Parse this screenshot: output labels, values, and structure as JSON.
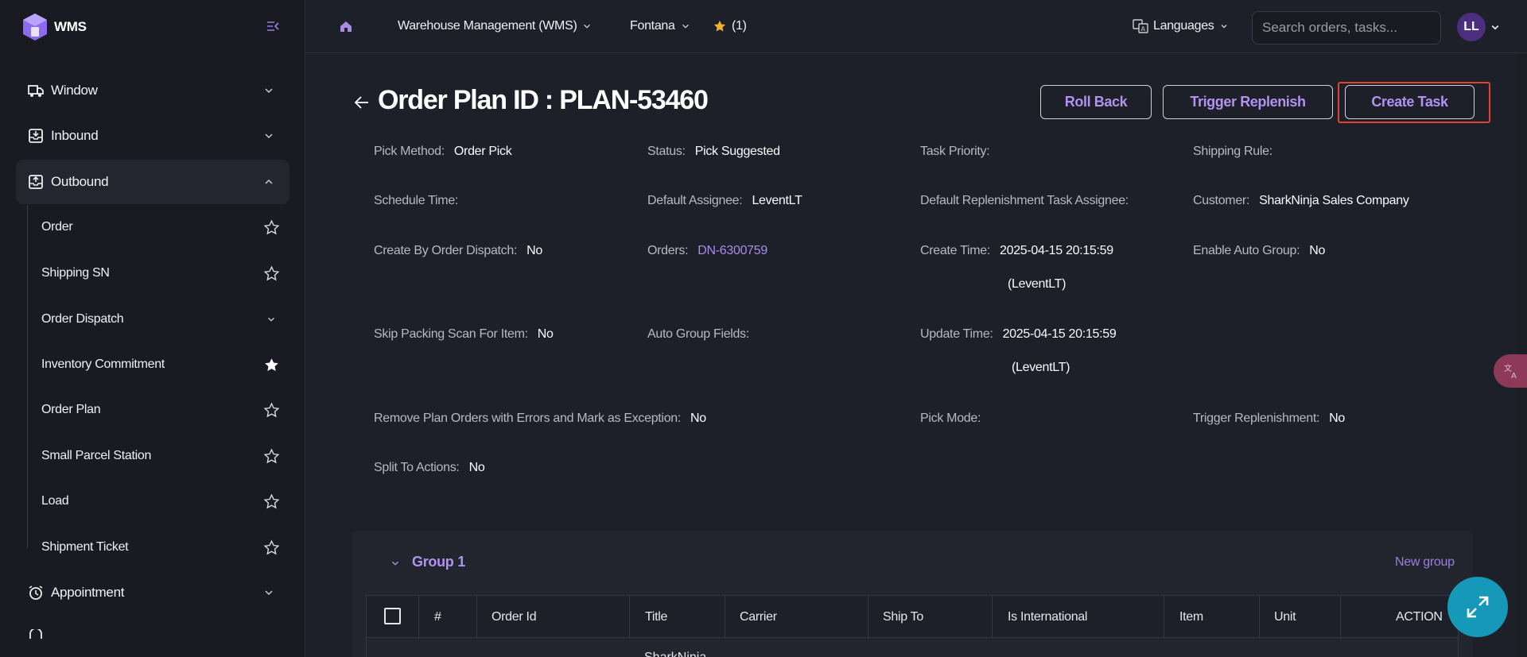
{
  "brand": {
    "name": "WMS"
  },
  "sidebar": {
    "groups": [
      {
        "label": "Window",
        "icon": "window-truck-icon"
      },
      {
        "label": "Inbound",
        "icon": "inbound-box-icon"
      },
      {
        "label": "Outbound",
        "icon": "outbound-box-icon"
      },
      {
        "label": "Appointment",
        "icon": "alarm-clock-icon"
      }
    ],
    "outbound_items": [
      {
        "label": "Order",
        "favorited": false
      },
      {
        "label": "Shipping SN",
        "favorited": false
      },
      {
        "label": "Order Dispatch",
        "expandable": true
      },
      {
        "label": "Inventory Commitment",
        "favorited": true
      },
      {
        "label": "Order Plan",
        "favorited": false
      },
      {
        "label": "Small Parcel Station",
        "favorited": false
      },
      {
        "label": "Load",
        "favorited": false
      },
      {
        "label": "Shipment Ticket",
        "favorited": false
      }
    ]
  },
  "topbar": {
    "app_selector": "Warehouse Management (WMS)",
    "facility": "Fontana",
    "favorites_count": "(1)",
    "languages": "Languages",
    "search_placeholder": "Search orders, tasks...",
    "avatar_initials": "LL"
  },
  "page": {
    "title": "Order Plan ID : PLAN-53460",
    "buttons": {
      "roll_back": "Roll Back",
      "trigger_replenish": "Trigger Replenish",
      "create_task": "Create Task"
    }
  },
  "details": {
    "pick_method": {
      "label": "Pick Method:",
      "value": "Order Pick"
    },
    "status": {
      "label": "Status:",
      "value": "Pick Suggested"
    },
    "task_priority": {
      "label": "Task Priority:",
      "value": ""
    },
    "shipping_rule": {
      "label": "Shipping Rule:",
      "value": ""
    },
    "schedule_time": {
      "label": "Schedule Time:",
      "value": ""
    },
    "default_assignee": {
      "label": "Default Assignee:",
      "value": "LeventLT"
    },
    "default_replenishment_assignee": {
      "label": "Default Replenishment Task Assignee:",
      "value": ""
    },
    "customer": {
      "label": "Customer:",
      "value": "SharkNinja Sales Company"
    },
    "create_by_order_dispatch": {
      "label": "Create By Order Dispatch:",
      "value": "No"
    },
    "orders": {
      "label": "Orders:",
      "value": "DN-6300759"
    },
    "create_time": {
      "label": "Create Time:",
      "value": "2025-04-15 20:15:59",
      "by": "(LeventLT)"
    },
    "enable_auto_group": {
      "label": "Enable Auto Group:",
      "value": "No"
    },
    "skip_packing_scan": {
      "label": "Skip Packing Scan For Item:",
      "value": "No"
    },
    "auto_group_fields": {
      "label": "Auto Group Fields:",
      "value": ""
    },
    "update_time": {
      "label": "Update Time:",
      "value": "2025-04-15 20:15:59",
      "by": "(LeventLT)"
    },
    "remove_plan_orders": {
      "label": "Remove Plan Orders with Errors and Mark as Exception:",
      "value": "No"
    },
    "pick_mode": {
      "label": "Pick Mode:",
      "value": ""
    },
    "trigger_replenishment": {
      "label": "Trigger Replenishment:",
      "value": "No"
    },
    "split_to_actions": {
      "label": "Split To Actions:",
      "value": "No"
    }
  },
  "group": {
    "title": "Group 1",
    "new_group": "New group",
    "columns": [
      "#",
      "Order Id",
      "Title",
      "Carrier",
      "Ship To",
      "Is International",
      "Item",
      "Unit",
      "ACTION"
    ],
    "first_row_title_peek": "SharkNinja"
  },
  "colors": {
    "accent": "#b292ef",
    "link": "#a98be6",
    "highlight": "#e0442f",
    "fab": "#1699b8"
  }
}
